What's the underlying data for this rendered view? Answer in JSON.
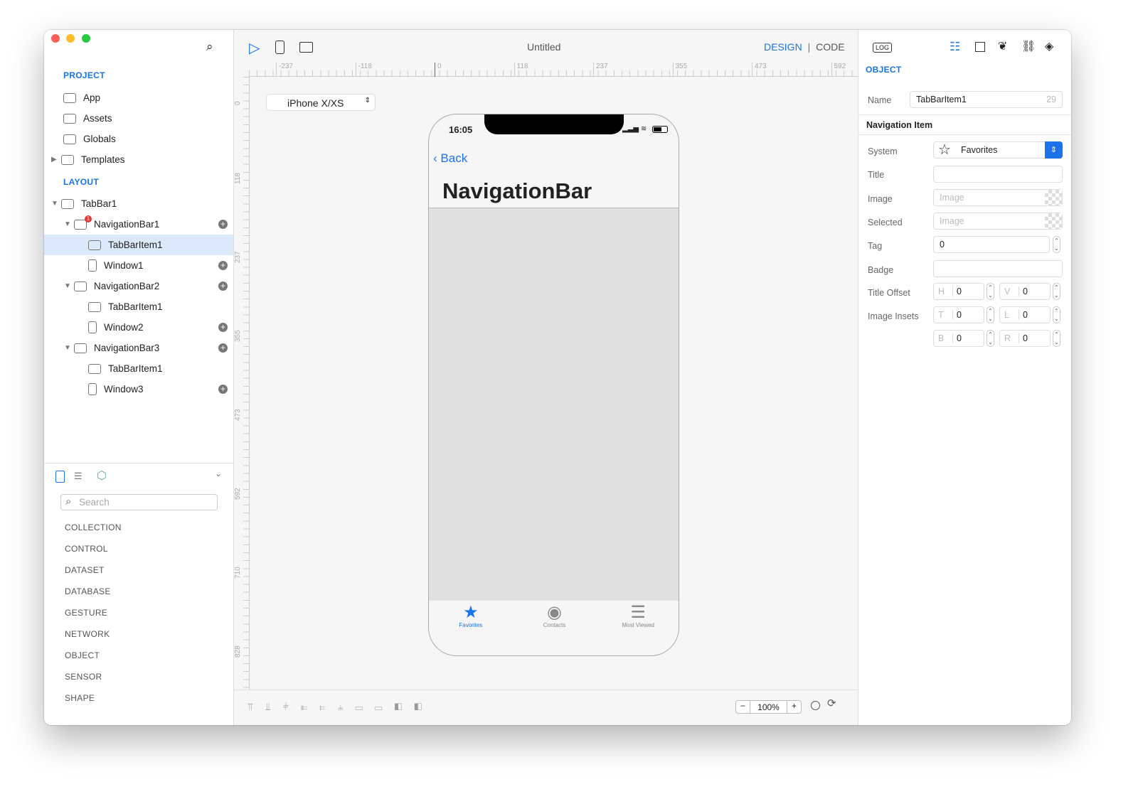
{
  "window": {
    "title": "Untitled",
    "mode_design": "DESIGN",
    "mode_sep": "|",
    "mode_code": "CODE"
  },
  "sidebar": {
    "project_header": "PROJECT",
    "project_items": [
      {
        "label": "App",
        "icon": "app-icon"
      },
      {
        "label": "Assets",
        "icon": "briefcase-icon"
      },
      {
        "label": "Globals",
        "icon": "globe-icon"
      },
      {
        "label": "Templates",
        "icon": "templates-icon"
      }
    ],
    "layout_header": "LAYOUT",
    "tree": [
      {
        "label": "TabBar1",
        "level": 0
      },
      {
        "label": "NavigationBar1",
        "level": 1,
        "badge": "1"
      },
      {
        "label": "TabBarItem1",
        "level": 2,
        "selected": true
      },
      {
        "label": "Window1",
        "level": 2
      },
      {
        "label": "NavigationBar2",
        "level": 1
      },
      {
        "label": "TabBarItem1",
        "level": 2
      },
      {
        "label": "Window2",
        "level": 2
      },
      {
        "label": "NavigationBar3",
        "level": 1
      },
      {
        "label": "TabBarItem1",
        "level": 2
      },
      {
        "label": "Window3",
        "level": 2
      }
    ],
    "search_placeholder": "Search",
    "categories": [
      "COLLECTION",
      "CONTROL",
      "DATASET",
      "DATABASE",
      "GESTURE",
      "NETWORK",
      "OBJECT",
      "SENSOR",
      "SHAPE"
    ]
  },
  "canvas": {
    "device": "iPhone X/XS",
    "ruler_h": [
      "-237",
      "-118",
      "0",
      "118",
      "237",
      "355",
      "473",
      "592"
    ],
    "ruler_v": [
      "0",
      "118",
      "237",
      "355",
      "473",
      "592",
      "710",
      "828"
    ],
    "phone": {
      "time": "16:05",
      "back": "Back",
      "title": "NavigationBar",
      "tabs": [
        {
          "label": "Favorites",
          "active": true
        },
        {
          "label": "Contacts"
        },
        {
          "label": "Most Viewed"
        }
      ]
    },
    "zoom": "100%",
    "zoom_minus": "−",
    "zoom_plus": "+"
  },
  "inspector": {
    "log": "LOG",
    "header": "OBJECT",
    "name_label": "Name",
    "name_value": "TabBarItem1",
    "name_count": "29",
    "section": "Navigation Item",
    "system_label": "System",
    "system_value": "Favorites",
    "title_label": "Title",
    "image_label": "Image",
    "image_placeholder": "Image",
    "selected_label": "Selected",
    "selected_placeholder": "Image",
    "tag_label": "Tag",
    "tag_value": "0",
    "badge_label": "Badge",
    "title_offset_label": "Title Offset",
    "h": "H",
    "h_value": "0",
    "v": "V",
    "v_value": "0",
    "image_insets_label": "Image Insets",
    "t": "T",
    "t_value": "0",
    "l": "L",
    "l_value": "0",
    "b": "B",
    "b_value": "0",
    "r": "R",
    "r_value": "0"
  },
  "colors": {
    "accent": "#1a73e8",
    "selected_row": "#dce9fb"
  }
}
